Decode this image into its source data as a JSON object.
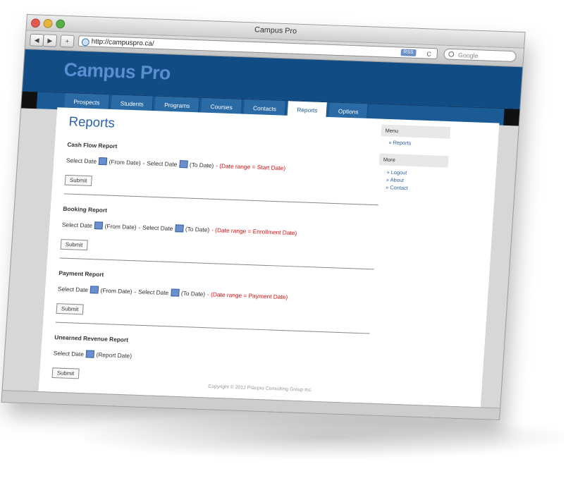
{
  "window": {
    "title": "Campus Pro"
  },
  "toolbar": {
    "back": "◀",
    "forward": "▶",
    "add": "+",
    "url": "http://campuspro.ca/",
    "url_badge": "RSS",
    "reload": "C",
    "search_placeholder": "Google"
  },
  "site": {
    "brand": "Campus Pro"
  },
  "nav": {
    "tabs": [
      "Prospects",
      "Students",
      "Programs",
      "Courses",
      "Contacts",
      "Reports",
      "Options"
    ]
  },
  "page": {
    "title": "Reports"
  },
  "reports": [
    {
      "title": "Cash Flow Report",
      "select": "Select Date",
      "from": "(From Date)",
      "sep": "-",
      "select2": "Select Date",
      "to": "(To Date)",
      "range": "- (Date range = Start Date)",
      "submit": "Submit"
    },
    {
      "title": "Booking Report",
      "select": "Select Date",
      "from": "(From Date)",
      "sep": "-",
      "select2": "Select Date",
      "to": "(To Date)",
      "range": "- (Date range = Enrollment Date)",
      "submit": "Submit"
    },
    {
      "title": "Payment Report",
      "select": "Select Date",
      "from": "(From Date)",
      "sep": "-",
      "select2": "Select Date",
      "to": "(To Date)",
      "range": "- (Date range = Payment Date)",
      "submit": "Submit"
    },
    {
      "title": "Unearned Revenue Report",
      "select": "Select Date",
      "from": "(Report Date)",
      "submit": "Submit"
    }
  ],
  "sidebar": {
    "menu_header": "Menu",
    "menu_items": [
      "» Reports"
    ],
    "more_header": "More",
    "more_items": [
      "» Logout",
      "» About",
      "» Contact"
    ]
  },
  "footer": {
    "text": "Copyright © 2012 Pracpro Consulting Group Inc."
  }
}
